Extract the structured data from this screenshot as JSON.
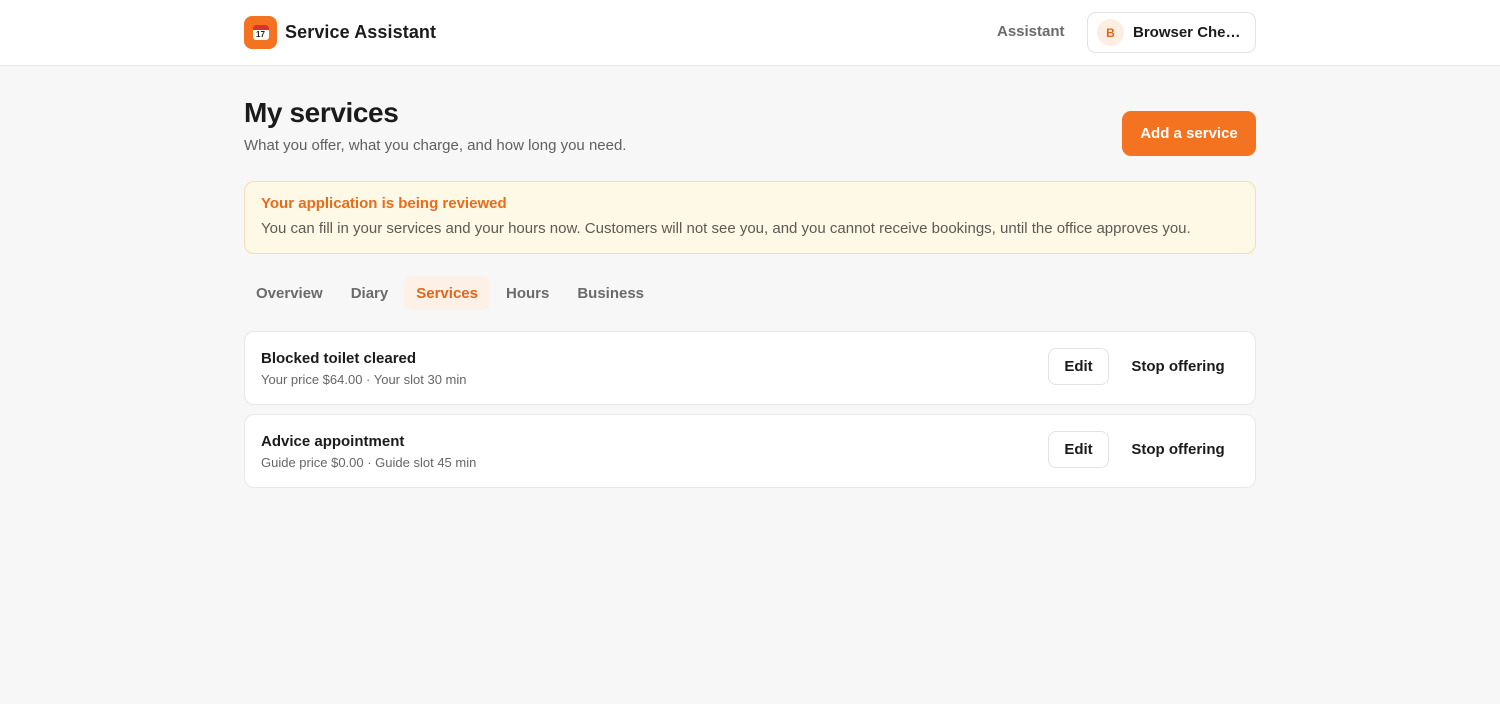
{
  "header": {
    "app_name": "Service Assistant",
    "logo_icon": "calendar-icon",
    "nav_link": "Assistant",
    "user": {
      "initial": "B",
      "name": "Browser Check…"
    }
  },
  "page": {
    "title": "My services",
    "subtitle": "What you offer, what you charge, and how long you need.",
    "add_button": "Add a service"
  },
  "notice": {
    "title": "Your application is being reviewed",
    "text": "You can fill in your services and your hours now. Customers will not see you, and you cannot receive bookings, until the office approves you."
  },
  "tabs": [
    {
      "label": "Overview",
      "active": false
    },
    {
      "label": "Diary",
      "active": false
    },
    {
      "label": "Services",
      "active": true
    },
    {
      "label": "Hours",
      "active": false
    },
    {
      "label": "Business",
      "active": false
    }
  ],
  "services": [
    {
      "name": "Blocked toilet cleared",
      "meta": "Your price $64.00 · Your slot 30 min",
      "edit_label": "Edit",
      "stop_label": "Stop offering"
    },
    {
      "name": "Advice appointment",
      "meta": "Guide price $0.00 · Guide slot 45 min",
      "edit_label": "Edit",
      "stop_label": "Stop offering"
    }
  ],
  "colors": {
    "accent": "#f47320",
    "notice_bg": "#fef8e7",
    "page_bg": "#f7f7f7"
  }
}
